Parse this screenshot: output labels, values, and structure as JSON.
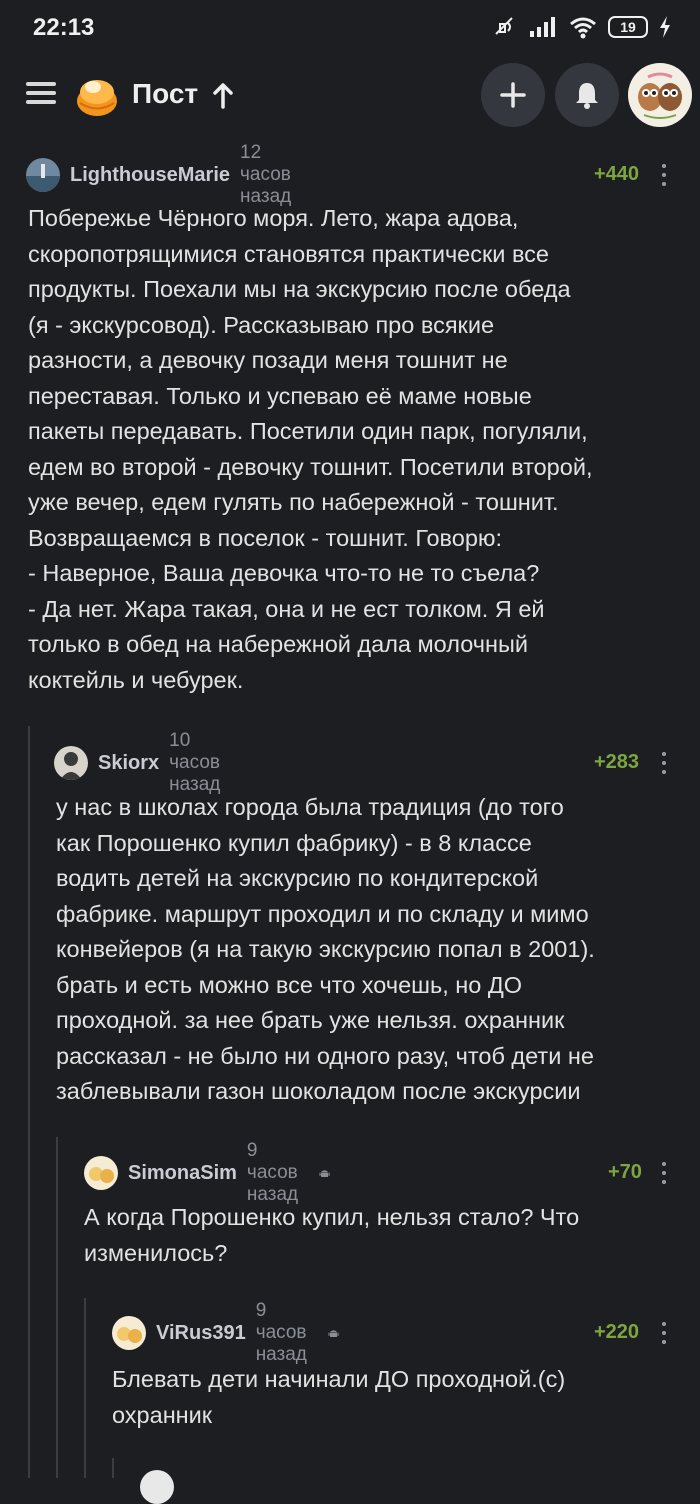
{
  "status_bar": {
    "time": "22:13",
    "battery": "19",
    "icons": [
      "mute-icon",
      "signal-icon",
      "wifi-icon",
      "battery-icon",
      "charging-icon"
    ]
  },
  "app_bar": {
    "title": "Пост",
    "icons": [
      "menu-icon",
      "logo-icon",
      "arrow-up-icon",
      "add-icon",
      "bell-icon",
      "avatar"
    ]
  },
  "colors": {
    "background": "#1c1e22",
    "score": "#7ea63f",
    "author": "#c9cdd3",
    "muted": "#8a8e95"
  },
  "comments": [
    {
      "author": "LighthouseMarie",
      "time": "12 часов назад",
      "score": "+440",
      "text": "Побережье Чёрного моря. Лето, жара адова,\nскоропотрящимися становятся практически все\nпродукты. Поехали мы на экскурсию после обеда\n(я - экскурсовод). Рассказываю про всякие\nразности, а девочку позади меня тошнит не\nпереставая. Только и успеваю её маме новые\nпакеты передавать. Посетили один парк, погуляли,\nедем во второй - девочку тошнит. Посетили второй,\nуже вечер, едем гулять по набережной - тошнит.\nВозвращаемся в поселок - тошнит. Говорю:\n- Наверное, Ваша девочка что-то не то съела?\n- Да нет. Жара такая, она и не ест толком. Я ей\nтолько в обед на набережной дала молочный\nкоктейль и чебурек."
    },
    {
      "author": "Skiorx",
      "time": "10 часов назад",
      "score": "+283",
      "text": "у нас в школах города была традиция (до того\nкак Порошенко купил фабрику) - в 8 классе\nводить детей на экскурсию по кондитерской\nфабрике. маршрут проходил и по складу и мимо\nконвейеров (я на такую экскурсию попал в 2001).\nбрать и есть можно все что хочешь, но ДО\nпроходной. за нее брать уже нельзя. охранник\nрассказал - не было ни одного разу, чтоб дети не\nзаблевывали газон шоколадом после экскурсии"
    },
    {
      "author": "SimonaSim",
      "time": "9 часов назад",
      "score": "+70",
      "text": "А когда Порошенко купил, нельзя стало? Что\nизменилось?"
    },
    {
      "author": "ViRus391",
      "time": "9 часов назад",
      "score": "+220",
      "text": "Блевать дети начинали ДО проходной.(с)\nохранник"
    }
  ]
}
